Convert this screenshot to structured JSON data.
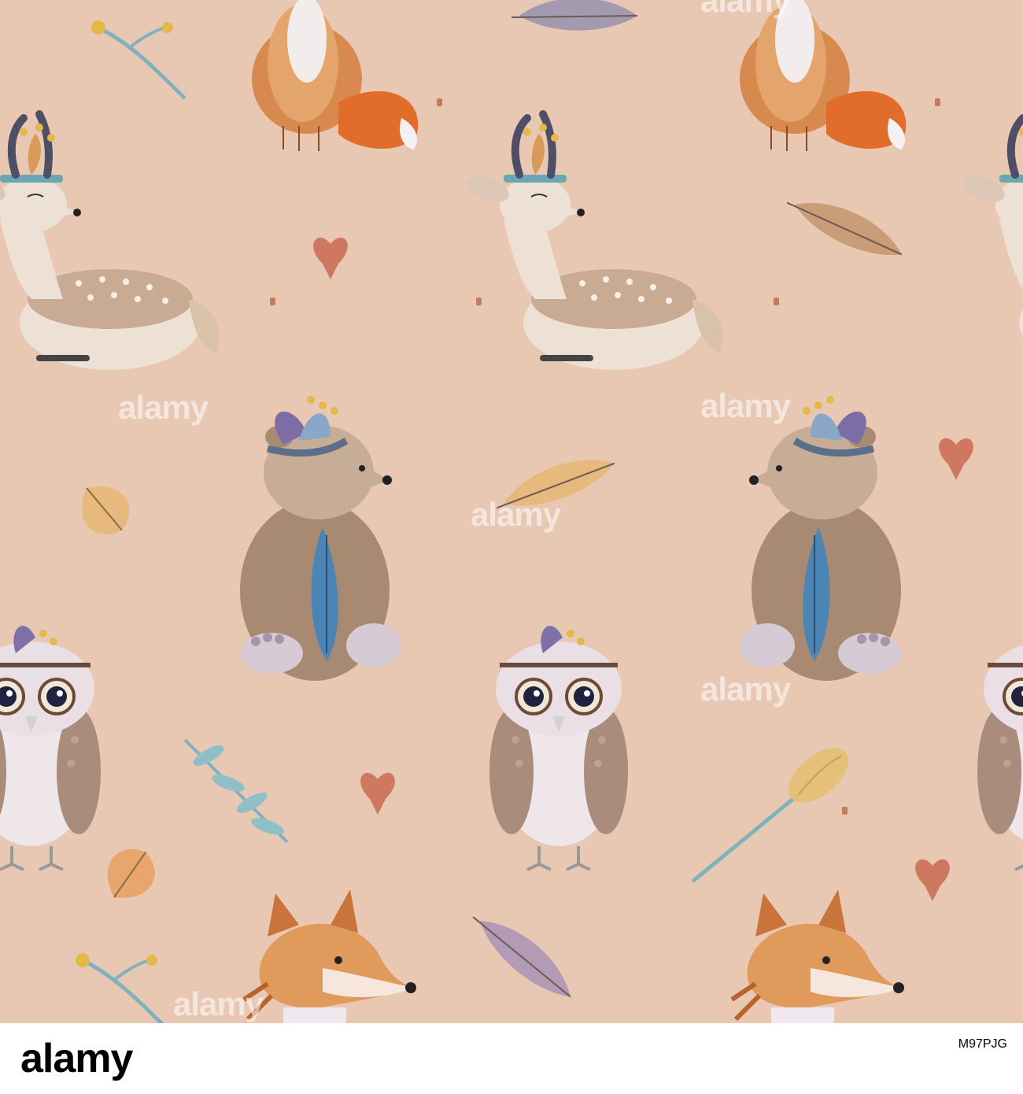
{
  "background_color": "#e9c8b3",
  "motifs": [
    "fox",
    "deer",
    "bear",
    "owl",
    "feather",
    "leaf",
    "heart",
    "berry-branch",
    "flower-bud"
  ],
  "watermark": {
    "text": "alamy"
  },
  "footer": {
    "logo_text": "alamy",
    "image_id": "M97PJG"
  }
}
